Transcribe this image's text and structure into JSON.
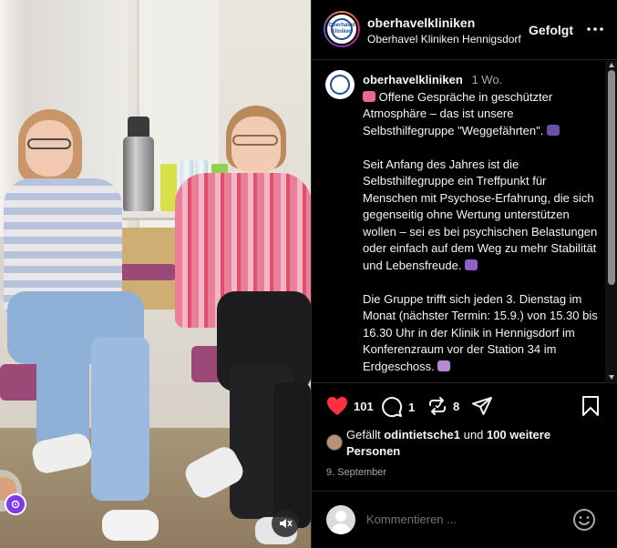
{
  "header": {
    "username": "oberhavelkliniken",
    "subtitle": "Oberhavel Kliniken Hennigsdorf",
    "follow_label": "Gefolgt",
    "logo_text": "Oberhavel Kliniken"
  },
  "caption": {
    "username": "oberhavelkliniken",
    "time": "1 Wo.",
    "p1": "Offene Gespräche in geschützter Atmosphäre – das ist unsere Selbsthilfegruppe \"Weggefährten\".",
    "p2": "Seit Anfang des Jahres ist die Selbsthilfegruppe ein Treffpunkt für Menschen mit Psychose-Erfahrung, die sich gegenseitig ohne Wertung unterstützen wollen – sei es bei psychischen Belastungen oder einfach auf dem Weg zu mehr Stabilität und Lebensfreude.",
    "p3": "Die Gruppe trifft sich jeden 3. Dienstag im Monat (nächster Termin: 15.9.) von 15.30 bis 16.30 Uhr in der Klinik in Hennigsdorf im Konferenzraum vor der Station 34 im Erdgeschoss."
  },
  "actions": {
    "likes_count": "101",
    "comments_count": "1",
    "reposts_count": "8"
  },
  "likes": {
    "prefix": "Gefällt",
    "user": "odintietsche1",
    "middle": "und",
    "others": "100 weitere Personen"
  },
  "date": "9. September",
  "comment": {
    "placeholder": "Kommentieren ..."
  },
  "colors": {
    "like_red": "#ff3040",
    "text": "#f5f5f5",
    "secondary": "#a8a8a8",
    "badge_purple": "#7c3aed"
  },
  "icons": [
    "heart-icon",
    "comment-icon",
    "repost-icon",
    "share-icon",
    "bookmark-icon",
    "more-icon",
    "mute-icon",
    "emoji-icon"
  ]
}
